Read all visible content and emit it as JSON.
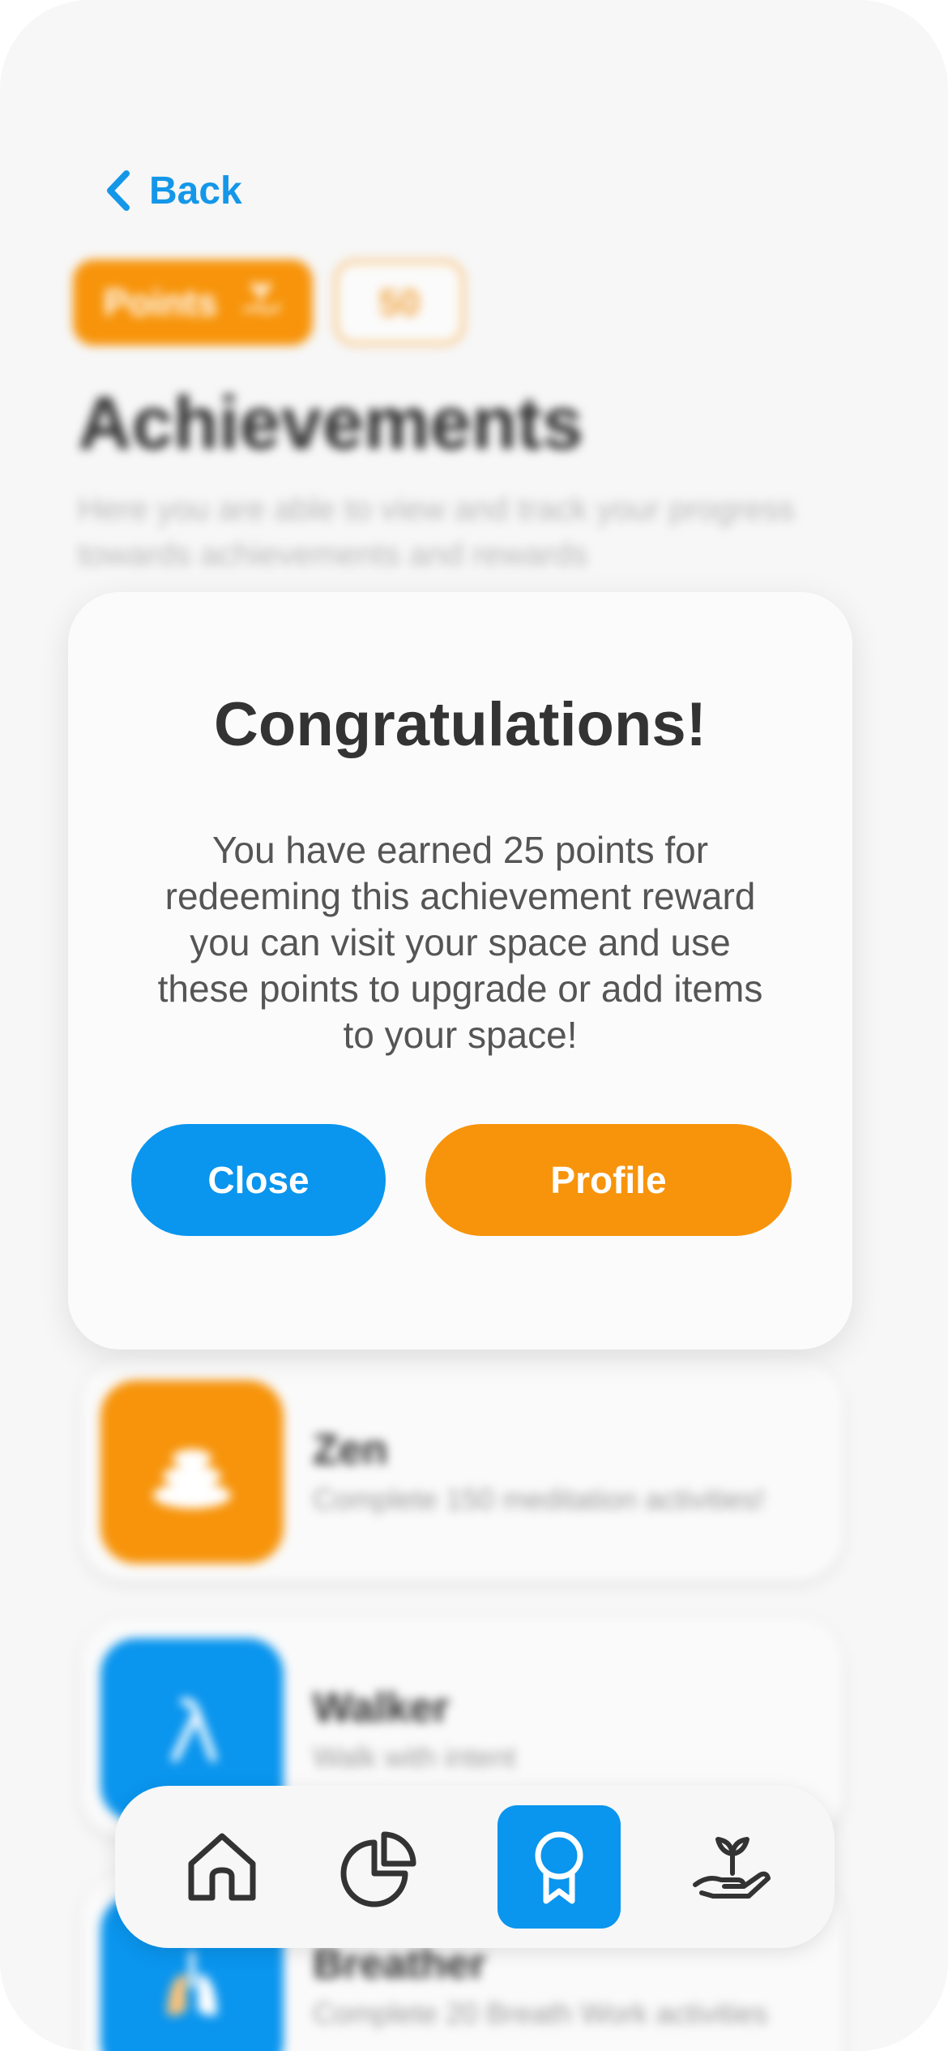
{
  "header": {
    "back_label": "Back"
  },
  "points": {
    "label": "Points",
    "value": "50"
  },
  "page": {
    "title": "Achievements",
    "subtitle": "Here you are able to view and track your progress towards achievements and rewards"
  },
  "achievements": [
    {
      "name": "Zen",
      "description": "Complete 150 meditation activities!",
      "color": "#f7940b",
      "icon": "stones-icon"
    },
    {
      "name": "Walker",
      "description": "Walk with intent",
      "color": "#0a95ee",
      "icon": "walker-icon"
    },
    {
      "name": "Breather",
      "description": "Complete 20 Breath Work activities",
      "color": "#0a95ee",
      "icon": "lungs-icon"
    }
  ],
  "modal": {
    "title": "Congratulations!",
    "body": "You have earned 25 points for redeeming this achievement reward you can visit your space and use these points to upgrade or add items to your space!",
    "close_label": "Close",
    "profile_label": "Profile"
  },
  "nav": {
    "items": [
      {
        "icon": "home-icon",
        "active": false
      },
      {
        "icon": "pie-chart-icon",
        "active": false
      },
      {
        "icon": "award-ribbon-icon",
        "active": true
      },
      {
        "icon": "plant-hand-icon",
        "active": false
      }
    ]
  },
  "colors": {
    "primary_blue": "#0a95ee",
    "accent_orange": "#f7940b",
    "text_dark": "#333333"
  }
}
